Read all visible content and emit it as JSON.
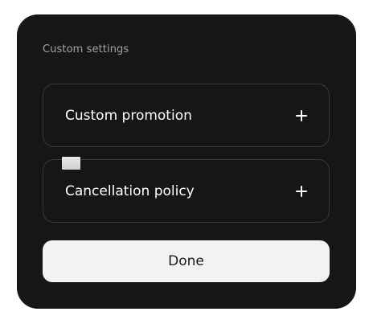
{
  "panel": {
    "title": "Custom settings",
    "options": [
      {
        "label": "Custom promotion",
        "icon": "plus-icon"
      },
      {
        "label": "Cancellation policy",
        "icon": "plus-icon"
      }
    ],
    "done_label": "Done"
  },
  "colors": {
    "panel_background": "#161616",
    "card_border": "#3a3a3a",
    "button_background": "#f2f2f2",
    "title_text": "#a3a3a3"
  }
}
